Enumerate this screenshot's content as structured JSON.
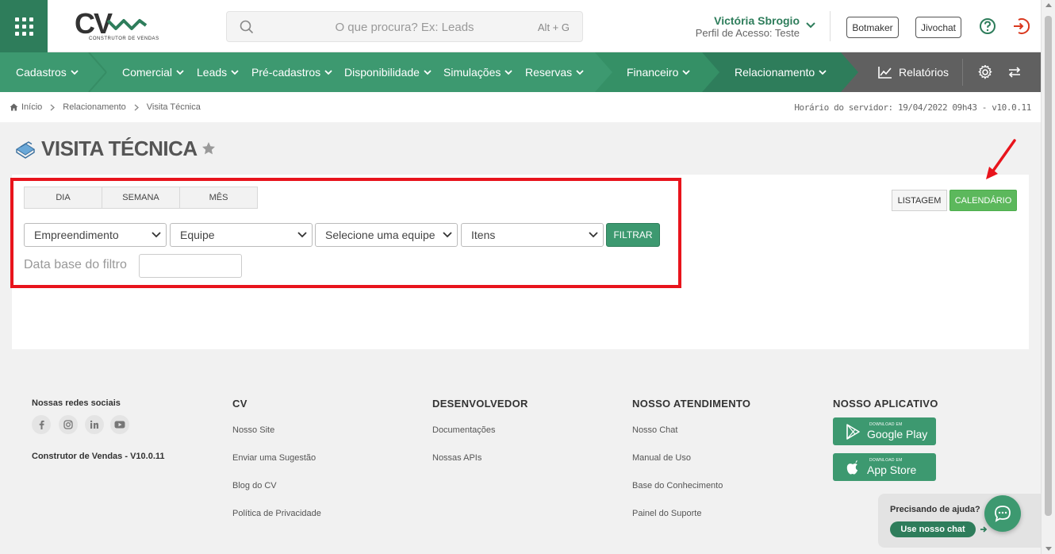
{
  "header": {
    "logo_text": "CV",
    "logo_tagline": "CONSTRUTOR DE VENDAS",
    "search_placeholder": "O que procura? Ex: Leads",
    "search_shortcut": "Alt + G",
    "user_name": "Victória Sbrogio",
    "user_role": "Perfil de Acesso: Teste",
    "botmaker_label": "Botmaker",
    "jivochat_label": "Jivochat"
  },
  "nav": {
    "items": [
      {
        "label": "Cadastros"
      },
      {
        "label": "Comercial"
      },
      {
        "label": "Leads"
      },
      {
        "label": "Pré-cadastros"
      },
      {
        "label": "Disponibilidade"
      },
      {
        "label": "Simulações"
      },
      {
        "label": "Reservas"
      },
      {
        "label": "Financeiro"
      },
      {
        "label": "Relacionamento"
      }
    ],
    "reports_label": "Relatórios"
  },
  "breadcrumb": {
    "items": [
      "Início",
      "Relacionamento",
      "Visita Técnica"
    ],
    "server_time": "Horário do servidor: 19/04/2022 09h43 - v10.0.11"
  },
  "page": {
    "title": "VISITA TÉCNICA"
  },
  "filters": {
    "tabs": [
      "DIA",
      "SEMANA",
      "MÊS"
    ],
    "selects": [
      "Empreendimento",
      "Equipe",
      "Selecione uma equipe",
      "Itens"
    ],
    "filter_button": "FILTRAR",
    "date_label": "Data base do filtro",
    "date_value": ""
  },
  "view_buttons": {
    "list": "LISTAGEM",
    "calendar": "CALENDÁRIO"
  },
  "footer": {
    "social_title": "Nossas redes sociais",
    "version": "Construtor de Vendas - V10.0.11",
    "columns": [
      {
        "title": "CV",
        "links": [
          "Nosso Site",
          "Enviar uma Sugestão",
          "Blog do CV",
          "Política de Privacidade"
        ]
      },
      {
        "title": "DESENVOLVEDOR",
        "links": [
          "Documentações",
          "Nossas APIs"
        ]
      },
      {
        "title": "NOSSO ATENDIMENTO",
        "links": [
          "Nosso Chat",
          "Manual de Uso",
          "Base do Conhecimento",
          "Painel do Suporte"
        ]
      },
      {
        "title": "NOSSO APLICATIVO",
        "links": []
      }
    ],
    "google_play_small": "DOWNLOAD EM",
    "google_play_big": "Google Play",
    "app_store_small": "DOWNLOAD EM",
    "app_store_big": "App Store"
  },
  "help": {
    "question": "Precisando de ajuda?",
    "button": "Use nosso chat"
  },
  "colors": {
    "brand_green": "#3d9970",
    "dark_green": "#2e7d5b",
    "highlight_red": "#e8141c",
    "calendar_green": "#5cb85c"
  }
}
